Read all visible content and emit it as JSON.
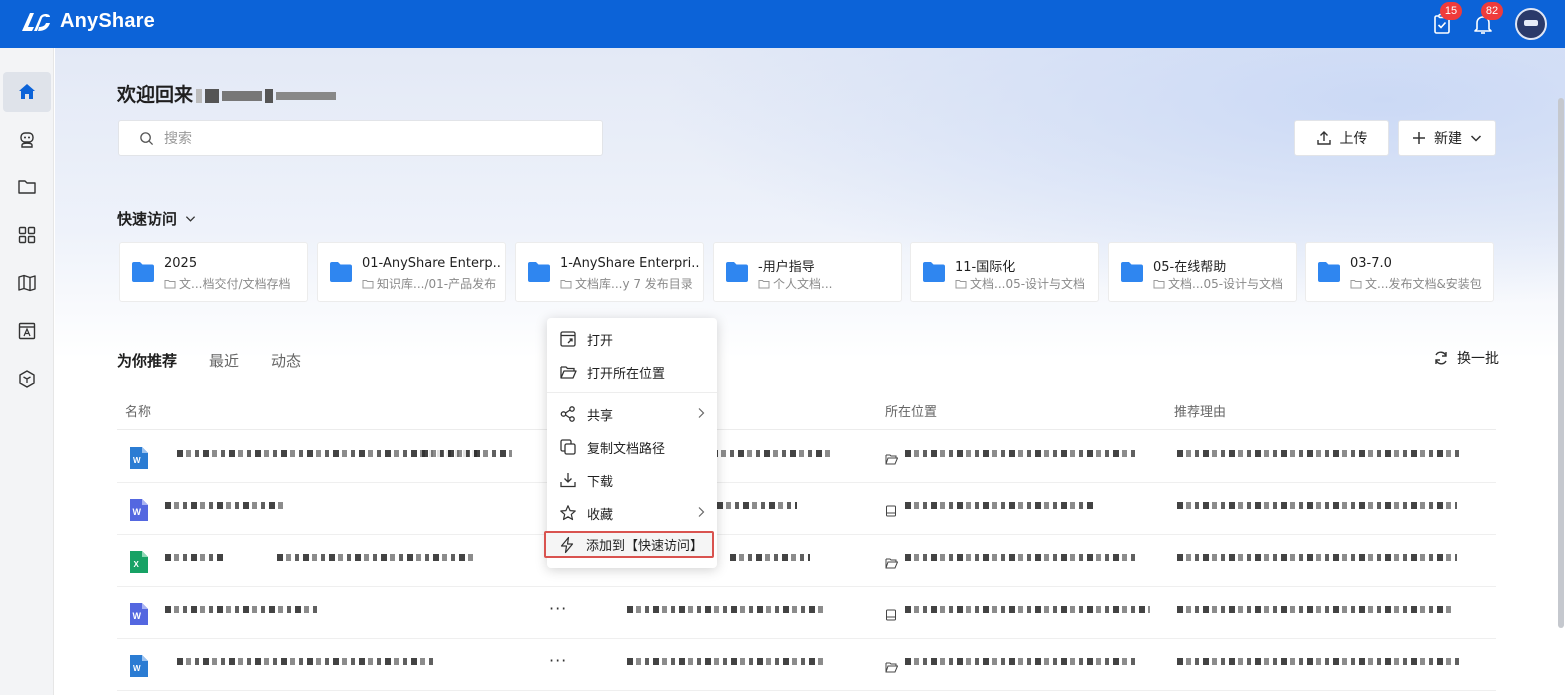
{
  "header": {
    "app_name": "AnyShare",
    "tasks_badge": "15",
    "notifications_badge": "82"
  },
  "sidebar": {
    "items": [
      {
        "icon": "home-icon",
        "active": true
      },
      {
        "icon": "robot-icon",
        "active": false
      },
      {
        "icon": "folder-icon",
        "active": false
      },
      {
        "icon": "apps-grid-icon",
        "active": false
      },
      {
        "icon": "map-icon",
        "active": false
      },
      {
        "icon": "document-viewer-icon",
        "active": false
      },
      {
        "icon": "hexagon-box-icon",
        "active": false
      }
    ]
  },
  "welcome": {
    "text": "欢迎回来"
  },
  "search": {
    "placeholder": "搜索"
  },
  "toolbar": {
    "upload_label": "上传",
    "new_label": "新建"
  },
  "quick_access": {
    "title": "快速访问",
    "cards": [
      {
        "name": "2025",
        "path": "文...档交付/文档存档"
      },
      {
        "name": "01-AnyShare Enterp...",
        "path": "知识库.../01-产品发布"
      },
      {
        "name": "1-AnyShare Enterpri...",
        "path": "文档库...y 7 发布目录"
      },
      {
        "name": "-用户指导",
        "path": "个人文档..."
      },
      {
        "name": "11-国际化",
        "path": "文档...05-设计与文档"
      },
      {
        "name": "05-在线帮助",
        "path": "文档...05-设计与文档"
      },
      {
        "name": "03-7.0",
        "path": "文...发布文档&安装包"
      }
    ]
  },
  "tabs": {
    "recommended": "为你推荐",
    "recent": "最近",
    "activity": "动态"
  },
  "refresh_label": "换一批",
  "table": {
    "col_name": "名称",
    "col_location": "所在位置",
    "col_reason": "推荐理由",
    "rows": [
      {
        "type": "word-doc",
        "location_icon": "folder-open-icon"
      },
      {
        "type": "wps-doc",
        "location_icon": "library-icon"
      },
      {
        "type": "excel-doc",
        "location_icon": "folder-open-icon"
      },
      {
        "type": "wps-doc",
        "location_icon": "library-icon"
      },
      {
        "type": "word-doc",
        "location_icon": "folder-open-icon"
      }
    ],
    "more_label": "···"
  },
  "context_menu": {
    "open": "打开",
    "open_location": "打开所在位置",
    "share": "共享",
    "copy_path": "复制文档路径",
    "download": "下载",
    "favorite": "收藏",
    "add_quick_access": "添加到【快速访问】"
  },
  "colors": {
    "brand_blue": "#0c63d8",
    "badge_red": "#ef3b3b",
    "folder_blue": "#2f86f0",
    "highlight_red": "#d9534f"
  }
}
